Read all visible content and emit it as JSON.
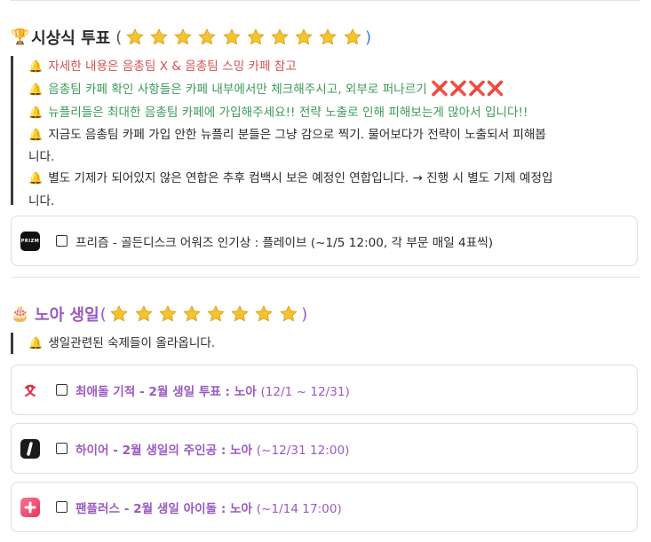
{
  "section1": {
    "emoji": "🏆",
    "title": "시상식 투표",
    "paren_open": "(",
    "paren_close": ")",
    "star_count": 10,
    "notes": [
      {
        "icon": "🔔",
        "text": "자세한 내용은 음총팀 X & 음총팀 스밍 카페 참고",
        "color": "red"
      },
      {
        "icon": "🔔",
        "text": "음총팀 카페 확인 사항들은 카페 내부에서만 체크해주시고, 외부로 퍼나르기",
        "suffix": "❌❌❌❌",
        "color": "green"
      },
      {
        "icon": "🔔",
        "text": "뉴플리들은 최대한 음총팀 카페에 가입해주세요!! 전략 노출로 인해 피해보는게 많아서 입니다!!",
        "color": "green"
      },
      {
        "icon": "🔔",
        "text": "지금도 음총팀 카페 가입 안한 뉴플리 분들은 그냥 감으로 찍기. 물어보다가 전략이 노출되서 피해봅",
        "cont": "니다.",
        "color": "dark"
      },
      {
        "icon": "🔔",
        "text": "별도 기제가 되어있지 않은 연합은 추후 컴백시 보은 예정인 연합입니다. → 진행 시 별도 기제 예정입",
        "cont": "니다.",
        "color": "dark"
      }
    ],
    "tasks": [
      {
        "app": "prizm-icon",
        "app_text": "PRIZM",
        "label": "프리즘 - 골든디스크 어워즈 인기상 : 플레이브 (~1/5 12:00, 각 부문 매일 4표씩)"
      }
    ]
  },
  "section2": {
    "emoji": "🎂",
    "title": "노아 생일",
    "paren_open": "(",
    "paren_close": ")",
    "star_count": 8,
    "notes": [
      {
        "icon": "🔔",
        "text": "생일관련된 숙제들이 올라옵니다.",
        "color": "dark"
      }
    ],
    "tasks": [
      {
        "app": "choeaedol-icon",
        "label": "최애돌 기적 - 2월 생일 투표 : 노아",
        "range": "(12/1 ~ 12/31)"
      },
      {
        "app": "hiour-icon",
        "label": "하이어 - 2월 생일의 주인공 : 노아",
        "range": "(~12/31 12:00)"
      },
      {
        "app": "fanplus-icon",
        "label": "팬플러스 - 2월 생일 아이돌 : 노아",
        "range": "(~1/14 17:00)"
      }
    ]
  },
  "colors": {
    "red": "#d35252",
    "green": "#3c9a55",
    "purple": "#9b59c2",
    "paren_blue": "#3b7fd6",
    "star": "#f5c32c"
  }
}
